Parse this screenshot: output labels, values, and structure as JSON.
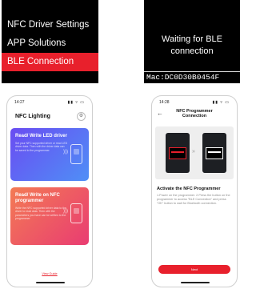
{
  "device_menu": {
    "items": [
      {
        "label": "NFC Driver Settings",
        "selected": false
      },
      {
        "label": "APP Solutions",
        "selected": false
      },
      {
        "label": "BLE Connection",
        "selected": true
      }
    ],
    "highlight_color": "#e8202c"
  },
  "device_wait": {
    "message": "Waiting for BLE connection",
    "mac": "Mac:DC0D30B0454F"
  },
  "phone_home": {
    "status_time": "14:27",
    "status_icons": "▮▮ ▿ ▭",
    "title": "NFC Lighting",
    "settings_icon": "gear-icon",
    "cards": [
      {
        "title": "Read/ Write LED driver",
        "desc": "Set your NFC supported driver or read LED driver data. Then with the driver data can be saved to the programmer."
      },
      {
        "title": "Read/ Write on NFC programmer",
        "desc": "Write the NFC supported driver data to the driver to read data. Then with the parameters you have can be written to the programmer."
      }
    ],
    "guide_link": "View Guide",
    "accent_color": "#e8202c"
  },
  "phone_connect": {
    "status_time": "14:28",
    "status_icons": "▮▮ ▿ ▭",
    "back_icon": "back-arrow-icon",
    "title": "NFC Programmer Connection",
    "illustration_arrow": "»",
    "activate_title": "Activate the NFC Programmer",
    "activate_desc": "1.Power on the programmer. 2.Press the button on the programmer to access \"BLE Connection\" and press \"OK\" button to wait for Bluetooth connection.",
    "next_label": "Next"
  }
}
